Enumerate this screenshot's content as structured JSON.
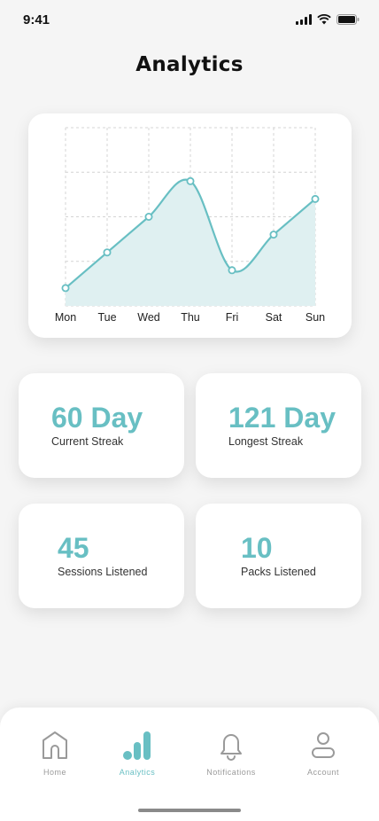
{
  "status": {
    "time": "9:41"
  },
  "page": {
    "title": "Analytics"
  },
  "chart_data": {
    "type": "line",
    "categories": [
      "Mon",
      "Tue",
      "Wed",
      "Thu",
      "Fri",
      "Sat",
      "Sun"
    ],
    "values": [
      1,
      3,
      5,
      7,
      2,
      4,
      6
    ],
    "ylim": [
      0,
      10
    ],
    "grid": true,
    "accent": "#68bfc3",
    "fill": "#dff0f1"
  },
  "stats": {
    "current_streak": {
      "value": "60 Day",
      "label": "Current Streak"
    },
    "longest_streak": {
      "value": "121 Day",
      "label": "Longest Streak"
    },
    "sessions": {
      "value": "45",
      "label": "Sessions Listened"
    },
    "packs": {
      "value": "10",
      "label": "Packs Listened"
    }
  },
  "nav": {
    "items": [
      {
        "label": "Home",
        "icon": "home-icon"
      },
      {
        "label": "Analytics",
        "icon": "analytics-icon",
        "active": true
      },
      {
        "label": "Notifications",
        "icon": "bell-icon"
      },
      {
        "label": "Account",
        "icon": "account-icon"
      }
    ]
  },
  "colors": {
    "accent": "#68bfc3",
    "inactive": "#9a9a9a"
  }
}
